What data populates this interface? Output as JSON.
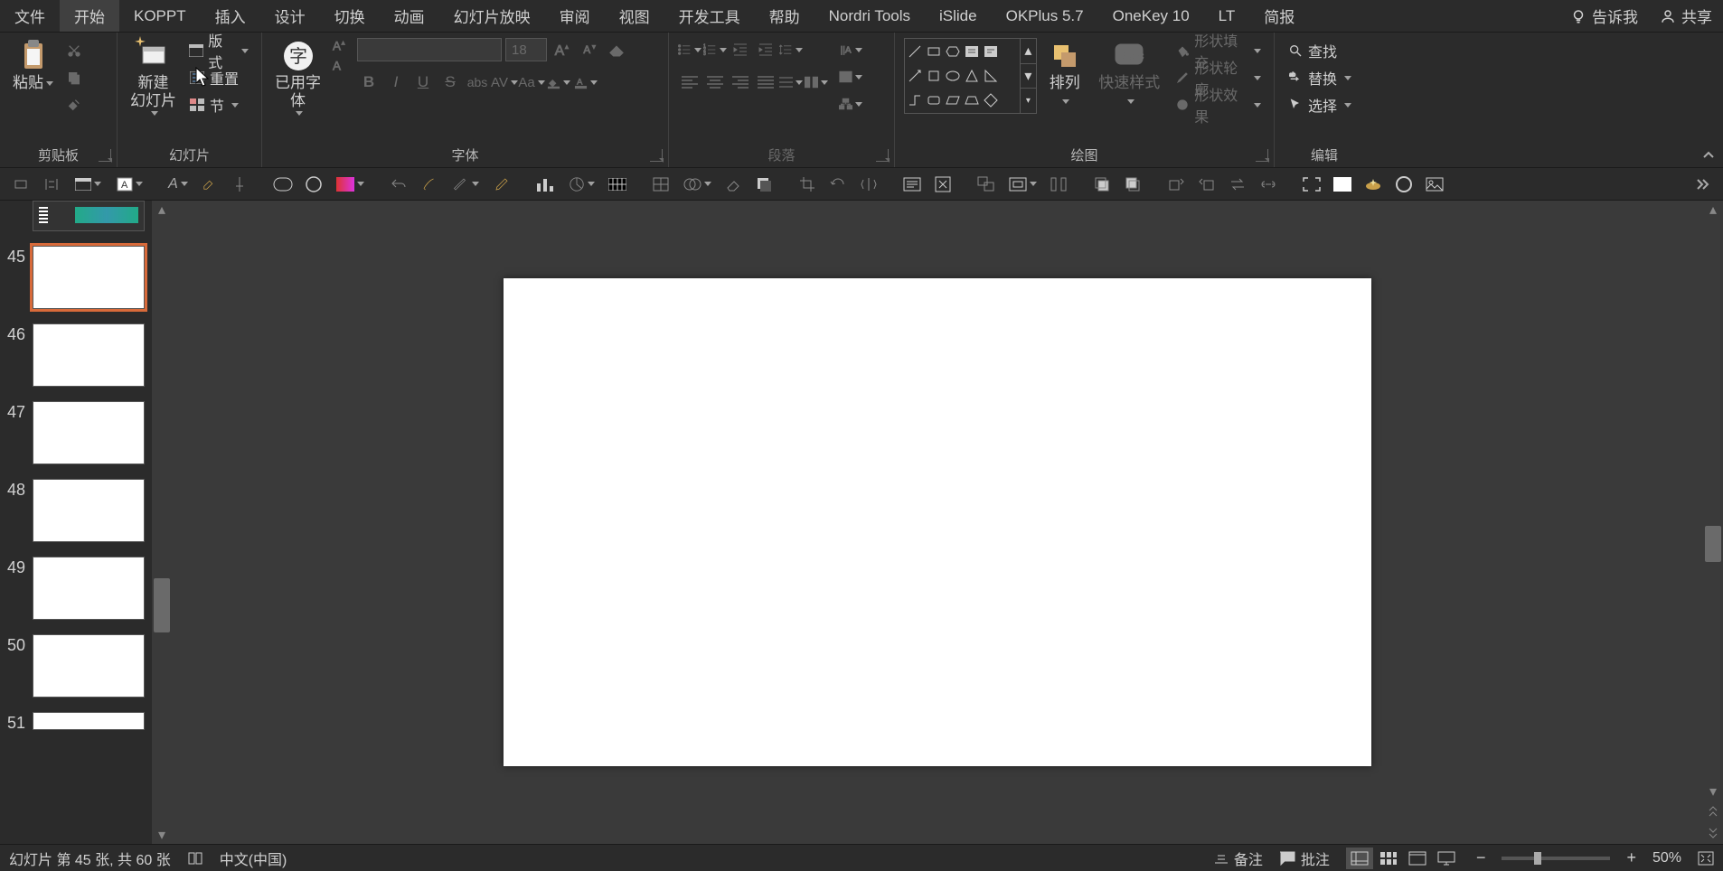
{
  "menu": {
    "file": "文件",
    "tabs": [
      "开始",
      "KOPPT",
      "插入",
      "设计",
      "切换",
      "动画",
      "幻灯片放映",
      "审阅",
      "视图",
      "开发工具",
      "帮助",
      "Nordri Tools",
      "iSlide",
      "OKPlus 5.7",
      "OneKey 10",
      "LT",
      "简报"
    ],
    "active_index": 0,
    "tell_me": "告诉我",
    "share": "共享"
  },
  "ribbon": {
    "clipboard": {
      "paste": "粘贴",
      "label": "剪贴板"
    },
    "slides": {
      "new_slide": "新建\n幻灯片",
      "layout": "版式",
      "reset": "重置",
      "section": "节",
      "label": "幻灯片"
    },
    "font": {
      "used_font": "已用字\n体",
      "size": "18",
      "label": "字体"
    },
    "paragraph": {
      "label": "段落"
    },
    "drawing": {
      "arrange": "排列",
      "quick_styles": "快速样式",
      "fill": "形状填充",
      "outline": "形状轮廓",
      "effects": "形状效果",
      "label": "绘图"
    },
    "editing": {
      "find": "查找",
      "replace": "替换",
      "select": "选择",
      "label": "编辑"
    }
  },
  "thumbs": {
    "visible": [
      {
        "n": "45",
        "selected": true
      },
      {
        "n": "46",
        "selected": false
      },
      {
        "n": "47",
        "selected": false
      },
      {
        "n": "48",
        "selected": false
      },
      {
        "n": "49",
        "selected": false
      },
      {
        "n": "50",
        "selected": false
      },
      {
        "n": "51",
        "selected": false
      }
    ]
  },
  "status": {
    "slide_info": "幻灯片 第 45 张, 共 60 张",
    "language": "中文(中国)",
    "notes": "备注",
    "comments": "批注",
    "zoom": "50%"
  },
  "colors": {
    "bg": "#2b2b2b",
    "panel": "#3a3a3a",
    "accent_selection": "#d86a3a"
  }
}
